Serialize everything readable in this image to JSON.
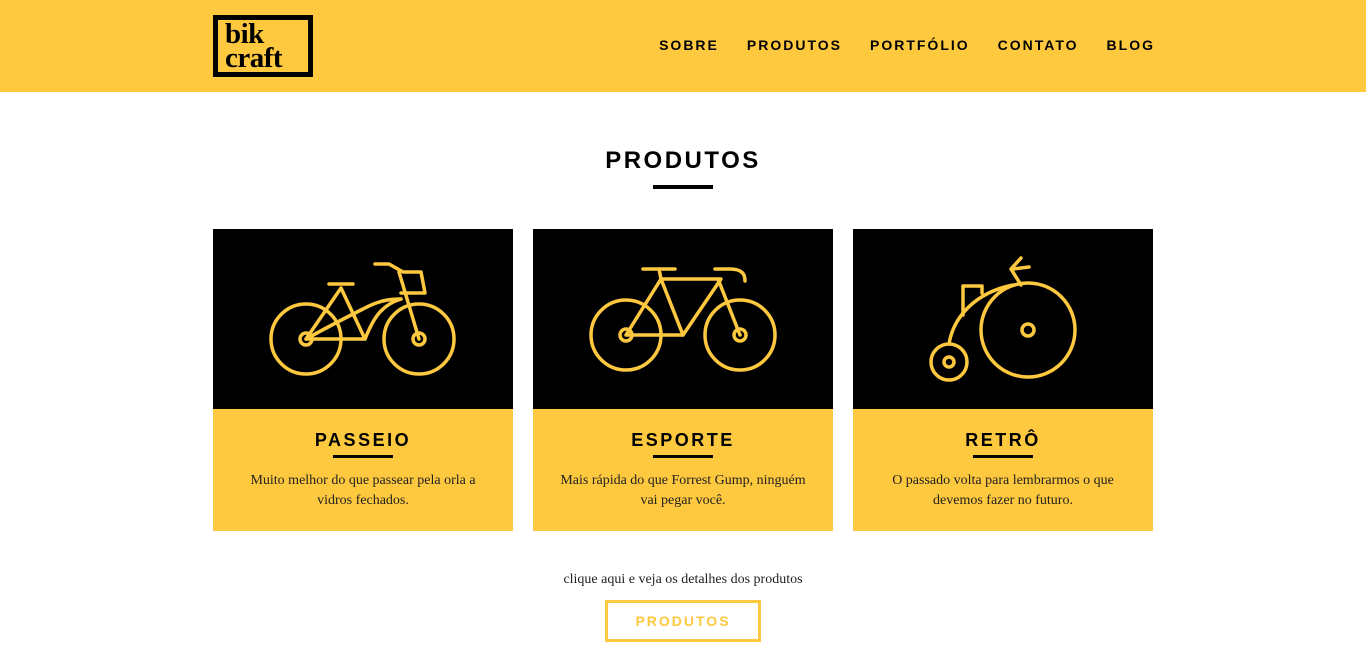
{
  "header": {
    "logo_line1": "bik",
    "logo_line2": "craft",
    "nav": [
      "SOBRE",
      "PRODUTOS",
      "PORTFÓLIO",
      "CONTATO",
      "BLOG"
    ]
  },
  "main": {
    "title": "PRODUTOS",
    "cards": [
      {
        "title": "PASSEIO",
        "description": "Muito melhor do que passear pela orla a vidros fechados.",
        "icon": "city-bike-icon"
      },
      {
        "title": "ESPORTE",
        "description": "Mais rápida do que Forrest Gump, ninguém vai pegar você.",
        "icon": "road-bike-icon"
      },
      {
        "title": "RETRÔ",
        "description": "O passado volta para lembrarmos o que devemos fazer no futuro.",
        "icon": "penny-farthing-icon"
      }
    ],
    "cta_text": "clique aqui e veja os detalhes dos produtos",
    "cta_button": "PRODUTOS"
  },
  "colors": {
    "accent": "#FEC83F",
    "dark": "#000000",
    "background": "#FFFFFF"
  }
}
